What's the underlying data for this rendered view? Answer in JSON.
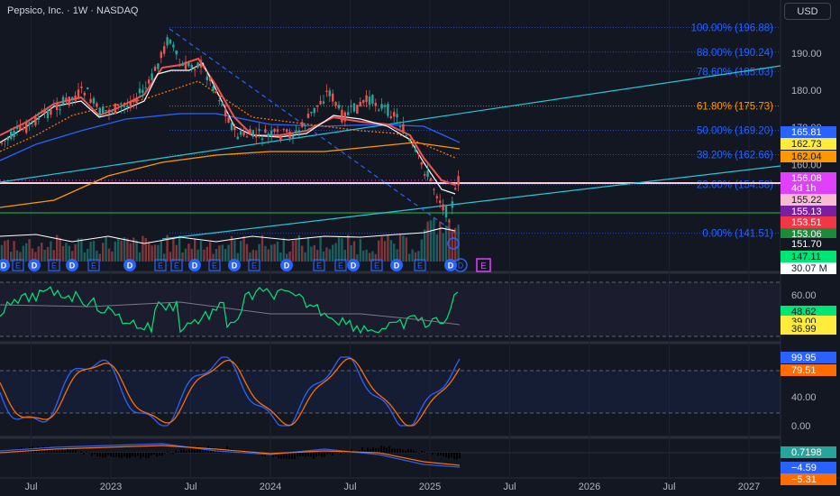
{
  "header": {
    "title": "Pepsico, Inc. · 1W · NASDAQ",
    "currency": "USD"
  },
  "colors": {
    "bg": "#131722",
    "up": "#26a69a",
    "down": "#ef5350",
    "fib": "#2962ff"
  },
  "chart_data": [
    {
      "type": "candlestick",
      "title": "Pepsico, Inc. · 1W · NASDAQ",
      "price_axis": [
        {
          "label": "190.00",
          "value": 190
        },
        {
          "label": "180.00",
          "value": 180
        },
        {
          "label": "170.00",
          "value": 170
        },
        {
          "label": "160.00",
          "value": 160
        }
      ],
      "x_ticks": [
        {
          "label": "Jul",
          "t": 2022.5
        },
        {
          "label": "2023",
          "t": 2023.0
        },
        {
          "label": "Jul",
          "t": 2023.5
        },
        {
          "label": "2024",
          "t": 2024.0
        },
        {
          "label": "Jul",
          "t": 2024.5
        },
        {
          "label": "2025",
          "t": 2025.0
        },
        {
          "label": "Jul",
          "t": 2025.5
        },
        {
          "label": "2026",
          "t": 2026.0
        },
        {
          "label": "Jul",
          "t": 2026.5
        },
        {
          "label": "2027",
          "t": 2027.0
        }
      ],
      "fib_levels": [
        {
          "label": "100.00% (196.88)",
          "value": 196.88,
          "color": "#2962ff"
        },
        {
          "label": "88.00% (190.24)",
          "value": 190.24,
          "color": "#2962ff"
        },
        {
          "label": "78.60% (185.03)",
          "value": 185.03,
          "color": "#2962ff"
        },
        {
          "label": "61.80% (175.73)",
          "value": 175.73,
          "color": "#ff9800"
        },
        {
          "label": "50.00% (169.20)",
          "value": 169.2,
          "color": "#2962ff"
        },
        {
          "label": "38.20% (162.66)",
          "value": 162.66,
          "color": "#2962ff"
        },
        {
          "label": "23.60% (154.58)",
          "value": 154.58,
          "color": "#2962ff"
        },
        {
          "label": "0.00% (141.51)",
          "value": 141.51,
          "color": "#2962ff"
        }
      ],
      "price_tags": [
        {
          "label": "165.81",
          "color": "#2962ff",
          "text": "#ffffff"
        },
        {
          "label": "162.73",
          "color": "#ffeb3b",
          "text": "#131722"
        },
        {
          "label": "162.04",
          "color": "#ff9800",
          "text": "#131722"
        },
        {
          "label": "156.08",
          "color": "#e040fb",
          "text": "#ffffff"
        },
        {
          "label": "4d 1h",
          "color": "#e040fb",
          "text": "#ffffff"
        },
        {
          "label": "155.22",
          "color": "#f8bbd0",
          "text": "#131722"
        },
        {
          "label": "155.13",
          "color": "#7b1fa2",
          "text": "#ffffff"
        },
        {
          "label": "153.51",
          "color": "#f23645",
          "text": "#ffffff"
        },
        {
          "label": "153.06",
          "color": "#1b8a3a",
          "text": "#ffffff"
        },
        {
          "label": "151.70",
          "color": "#131722",
          "text": "#ffffff"
        },
        {
          "label": "147.11",
          "color": "#00e676",
          "text": "#131722"
        },
        {
          "label": "30.07 M",
          "color": "#ffffff",
          "text": "#131722"
        }
      ],
      "events": [
        "D",
        "E",
        "D",
        "E",
        "D",
        "E",
        "D",
        "E",
        "E",
        "D",
        "E",
        "D",
        "E",
        "D",
        "E",
        "E",
        "D",
        "E",
        "D",
        "E",
        "D",
        "E",
        "D",
        "E",
        "D",
        "E"
      ]
    },
    {
      "type": "line",
      "name": "oscillator-1",
      "axis": [
        {
          "label": "60.00",
          "value": 60
        }
      ],
      "tags": [
        {
          "label": "48.62",
          "color": "#00e676",
          "text": "#131722"
        },
        {
          "label": "39.00",
          "color": "#ffeb3b",
          "text": "#131722"
        },
        {
          "label": "36.99",
          "color": "#ffeb3b",
          "text": "#131722"
        }
      ]
    },
    {
      "type": "line",
      "name": "oscillator-2",
      "axis": [
        {
          "label": "40.00",
          "value": 40
        },
        {
          "label": "0.00",
          "value": 0
        }
      ],
      "tags": [
        {
          "label": "99.95",
          "color": "#2962ff",
          "text": "#ffffff"
        },
        {
          "label": "79.51",
          "color": "#ff6d00",
          "text": "#ffffff"
        }
      ]
    },
    {
      "type": "histogram",
      "name": "oscillator-3",
      "tags": [
        {
          "label": "0.7198",
          "color": "#26a69a",
          "text": "#ffffff"
        },
        {
          "label": "−4.59",
          "color": "#2962ff",
          "text": "#ffffff"
        },
        {
          "label": "−5.31",
          "color": "#ff6d00",
          "text": "#ffffff"
        }
      ]
    }
  ]
}
